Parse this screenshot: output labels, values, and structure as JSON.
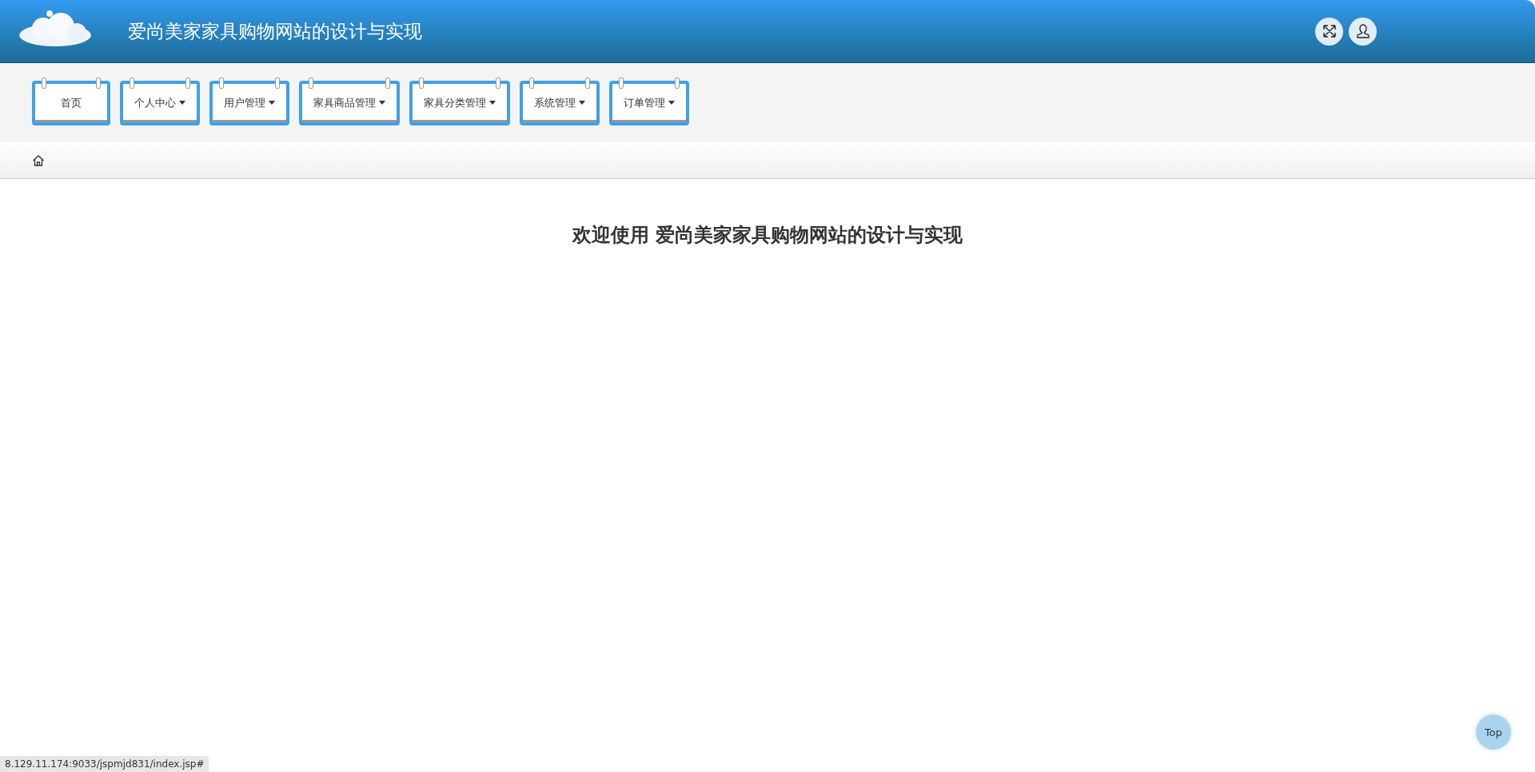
{
  "header": {
    "title": "爱尚美家家具购物网站的设计与实现"
  },
  "nav": [
    {
      "label": "首页",
      "dropdown": false
    },
    {
      "label": "个人中心",
      "dropdown": true
    },
    {
      "label": "用户管理",
      "dropdown": true
    },
    {
      "label": "家具商品管理",
      "dropdown": true
    },
    {
      "label": "家具分类管理",
      "dropdown": true
    },
    {
      "label": "系统管理",
      "dropdown": true
    },
    {
      "label": "订单管理",
      "dropdown": true
    }
  ],
  "welcome": "欢迎使用 爱尚美家家具购物网站的设计与实现",
  "top_button": "Top",
  "status_url": "8.129.11.174:9033/jspmjd831/index.jsp#"
}
